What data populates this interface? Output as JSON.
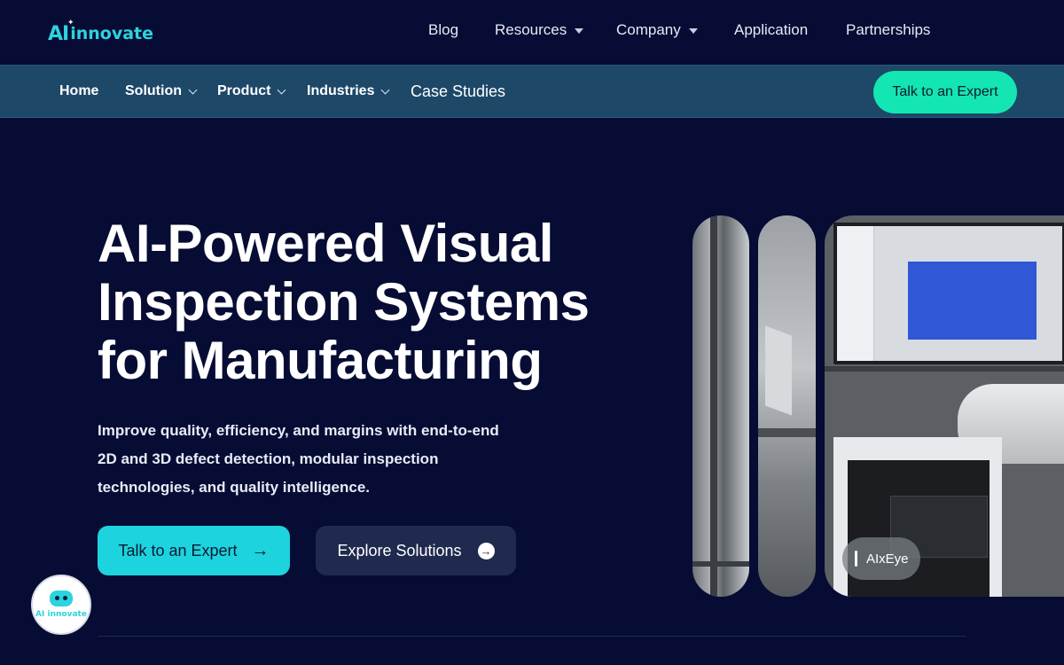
{
  "logo": {
    "ai": "AI",
    "text": "innovate"
  },
  "topnav": {
    "items": [
      {
        "label": "Blog",
        "dropdown": false
      },
      {
        "label": "Resources",
        "dropdown": true
      },
      {
        "label": "Company",
        "dropdown": true
      },
      {
        "label": "Application",
        "dropdown": false
      },
      {
        "label": "Partnerships",
        "dropdown": false
      }
    ]
  },
  "subnav": {
    "items": [
      {
        "label": "Home",
        "dropdown": false
      },
      {
        "label": "Solution",
        "dropdown": true
      },
      {
        "label": "Product",
        "dropdown": true
      },
      {
        "label": "Industries",
        "dropdown": true
      },
      {
        "label": "Case Studies",
        "dropdown": false
      }
    ],
    "cta_label": "Talk to an Expert"
  },
  "hero": {
    "title_lines": [
      "AI-Powered Visual",
      "Inspection Systems",
      "for Manufacturing"
    ],
    "description_lines": [
      "Improve quality, efficiency, and margins with end-to-end",
      "2D and 3D defect detection, modular inspection",
      "technologies, and quality intelligence."
    ],
    "primary_button": "Talk to an Expert",
    "secondary_button": "Explore Solutions",
    "image_badge": "AIxEye"
  },
  "chatbot": {
    "label": "AI innovate"
  },
  "colors": {
    "background": "#060c33",
    "subnav": "#1d4868",
    "accent_green": "#13e6b2",
    "accent_cyan": "#1dd3dd",
    "secondary_button": "#1f2a4e"
  }
}
